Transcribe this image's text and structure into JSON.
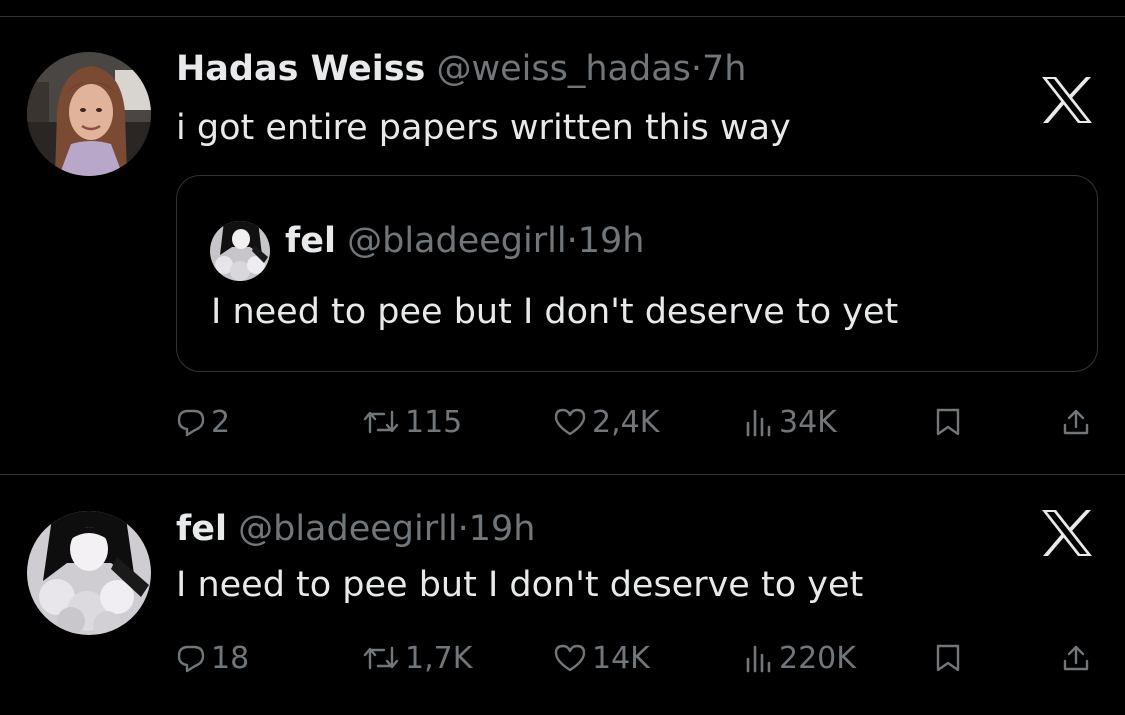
{
  "colors": {
    "background": "#000000",
    "text_primary": "#e7e9ea",
    "text_secondary": "#71767b",
    "border": "#2f3336"
  },
  "tweet_1": {
    "author_name": "Hadas Weiss",
    "handle": "@weiss_hadas",
    "separator": "·",
    "time": "7h",
    "text": "i got entire papers written this way",
    "x_icon": "x-logo-icon",
    "quote": {
      "author_name": "fel",
      "handle": "@bladeegirll",
      "separator": "·",
      "time": "19h",
      "text": "I need to pee but I don't deserve to yet"
    },
    "actions": {
      "replies": "2",
      "reposts": "115",
      "likes": "2,4K",
      "views": "34K"
    }
  },
  "tweet_2": {
    "author_name": "fel",
    "handle": "@bladeegirll",
    "separator": "·",
    "time": "19h",
    "text": "I need to pee but I don't deserve to yet",
    "x_icon": "x-logo-icon",
    "actions": {
      "replies": "18",
      "reposts": "1,7K",
      "likes": "14K",
      "views": "220K"
    }
  }
}
